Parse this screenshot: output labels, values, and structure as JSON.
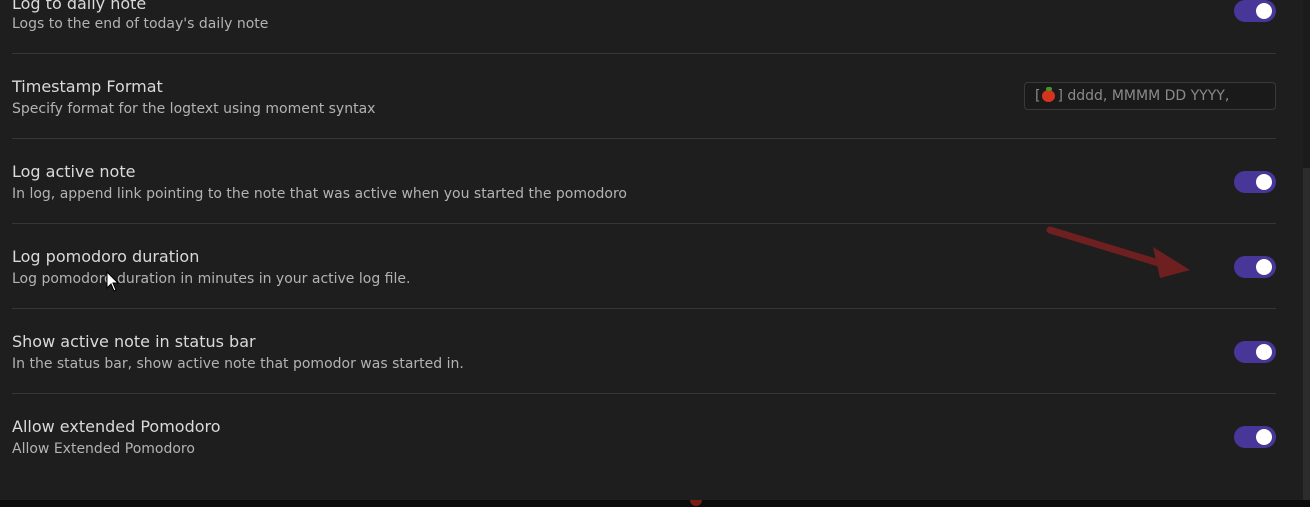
{
  "settings": [
    {
      "name": "Log to daily note",
      "description": "Logs to the end of today's daily note",
      "control": "toggle",
      "enabled": true
    },
    {
      "name": "Timestamp Format",
      "description": "Specify format for the logtext using moment syntax",
      "control": "text",
      "value_prefix": "[",
      "value_icon": "tomato-emoji-icon",
      "value_suffix": "] dddd, MMMM DD YYYY,"
    },
    {
      "name": "Log active note",
      "description": "In log, append link pointing to the note that was active when you started the pomodoro",
      "control": "toggle",
      "enabled": true
    },
    {
      "name": "Log pomodoro duration",
      "description": "Log pomodoro duration in minutes in your active log file.",
      "control": "toggle",
      "enabled": true
    },
    {
      "name": "Show active note in status bar",
      "description": "In the status bar, show active note that pomodor was started in.",
      "control": "toggle",
      "enabled": true
    },
    {
      "name": "Allow extended Pomodoro",
      "description": "Allow Extended Pomodoro",
      "control": "toggle",
      "enabled": true
    }
  ],
  "colors": {
    "background": "#1e1e1e",
    "toggle_on": "#483699",
    "divider": "#363636",
    "annotation_arrow": "#6e1f1f"
  },
  "overlays": {
    "annotation_arrow_icon": "arrow-pointing-right-icon",
    "cursor_icon": "mouse-pointer-icon"
  }
}
